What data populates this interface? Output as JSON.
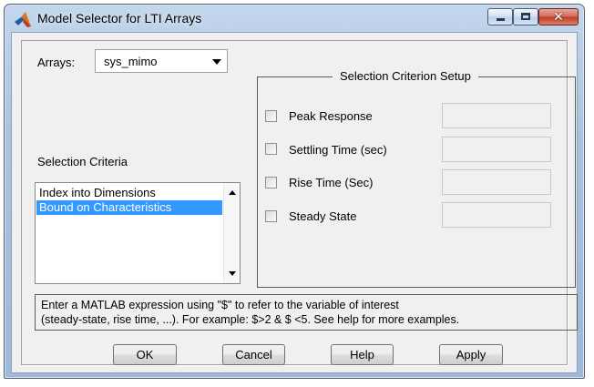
{
  "window": {
    "title": "Model Selector for LTI Arrays",
    "close_glyph": "✕"
  },
  "arrays": {
    "label": "Arrays:",
    "selected": "sys_mimo"
  },
  "selection_criteria": {
    "label": "Selection Criteria",
    "items": [
      "Index into Dimensions",
      "Bound on Characteristics"
    ],
    "selected_index": 1
  },
  "setup": {
    "title": "Selection Criterion Setup",
    "criteria": [
      {
        "label": "Peak Response",
        "checked": false,
        "value": ""
      },
      {
        "label": "Settling Time (sec)",
        "checked": false,
        "value": ""
      },
      {
        "label": "Rise Time (Sec)",
        "checked": false,
        "value": ""
      },
      {
        "label": "Steady State",
        "checked": false,
        "value": ""
      }
    ]
  },
  "help": {
    "line1": "Enter a MATLAB expression using \"$\" to refer to the variable of interest",
    "line2": "(steady-state, rise time, ...). For example: $>2 & $ <5.  See help for more examples."
  },
  "buttons": {
    "ok": "OK",
    "cancel": "Cancel",
    "help": "Help",
    "apply": "Apply"
  },
  "icons": {
    "app": "matlab-logo-icon",
    "minimize": "minimize-icon",
    "maximize": "maximize-icon",
    "close": "close-icon",
    "dropdown": "chevron-down-icon",
    "scroll_up": "scroll-up-icon",
    "scroll_down": "scroll-down-icon"
  },
  "colors": {
    "selection": "#3399ff",
    "title_bar": "#a9c3e0",
    "close_button": "#c23a22"
  }
}
